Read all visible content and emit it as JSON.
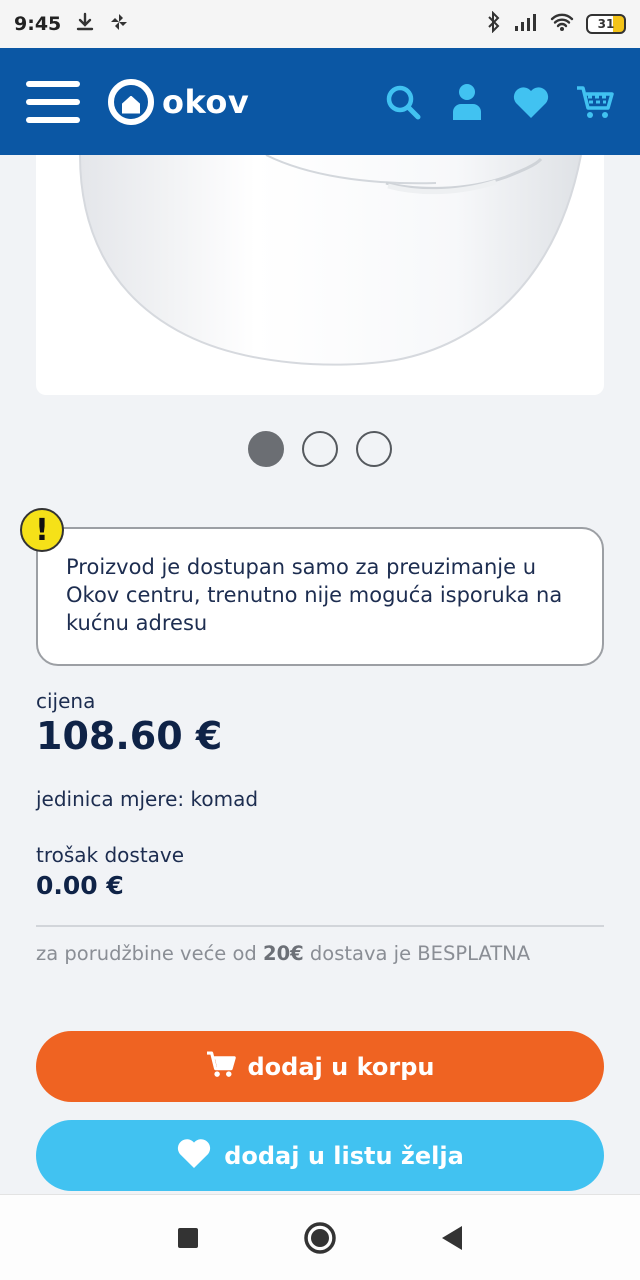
{
  "status_bar": {
    "time": "9:45",
    "battery": "31"
  },
  "header": {
    "logo_text": "okov",
    "icons": [
      "search-icon",
      "user-icon",
      "heart-icon",
      "cart-icon"
    ],
    "colors": {
      "background": "#0b57a4",
      "icon_accent": "#41c2f1"
    }
  },
  "carousel": {
    "total": 3,
    "active_index": 0
  },
  "notice": {
    "text": "Proizvod je dostupan samo za preuzimanje u Okov centru, trenutno nije moguća isporuka na kućnu adresu",
    "icon": "warning-icon",
    "icon_text": "!"
  },
  "price": {
    "label": "cijena",
    "value": "108.60 €"
  },
  "unit": {
    "text": "jedinica mjere: komad"
  },
  "delivery": {
    "label": "trošak dostave",
    "value": "0.00 €"
  },
  "free_delivery": {
    "before": "za porudžbine veće od",
    "amount": "20€",
    "after": "dostava je BESPLATNA"
  },
  "buttons": {
    "add_to_cart": "dodaj u korpu",
    "add_to_wishlist": "dodaj u listu želja",
    "cart_color": "#ef6322",
    "wishlist_color": "#41c2f1"
  },
  "nav_bar": {
    "buttons": [
      "recents-button",
      "home-button",
      "back-button"
    ]
  }
}
